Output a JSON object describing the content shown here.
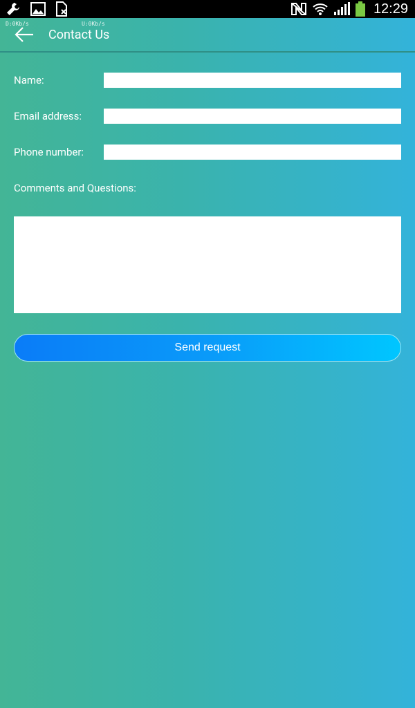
{
  "statusbar": {
    "time": "12:29",
    "download_speed": "D:0Kb/s",
    "upload_speed": "U:0Kb/s",
    "left_icons": [
      "wrench-icon",
      "image-icon",
      "sim-card-icon"
    ],
    "right_icons": [
      "nfc-off-icon",
      "wifi-icon",
      "signal-icon",
      "battery-icon"
    ],
    "battery_color": "#7ac943"
  },
  "header": {
    "title": "Contact Us",
    "back_icon": "arrow-left-icon"
  },
  "form": {
    "name_label": "Name:",
    "email_label": "Email address:",
    "phone_label": "Phone number:",
    "comments_label": "Comments and Questions:",
    "name_value": "",
    "email_value": "",
    "phone_value": "",
    "comments_value": ""
  },
  "actions": {
    "send_label": "Send request"
  },
  "colors": {
    "background_start": "#43b596",
    "background_end": "#33b3da",
    "button_start": "#0a7cf8",
    "button_end": "#00c6ff"
  }
}
